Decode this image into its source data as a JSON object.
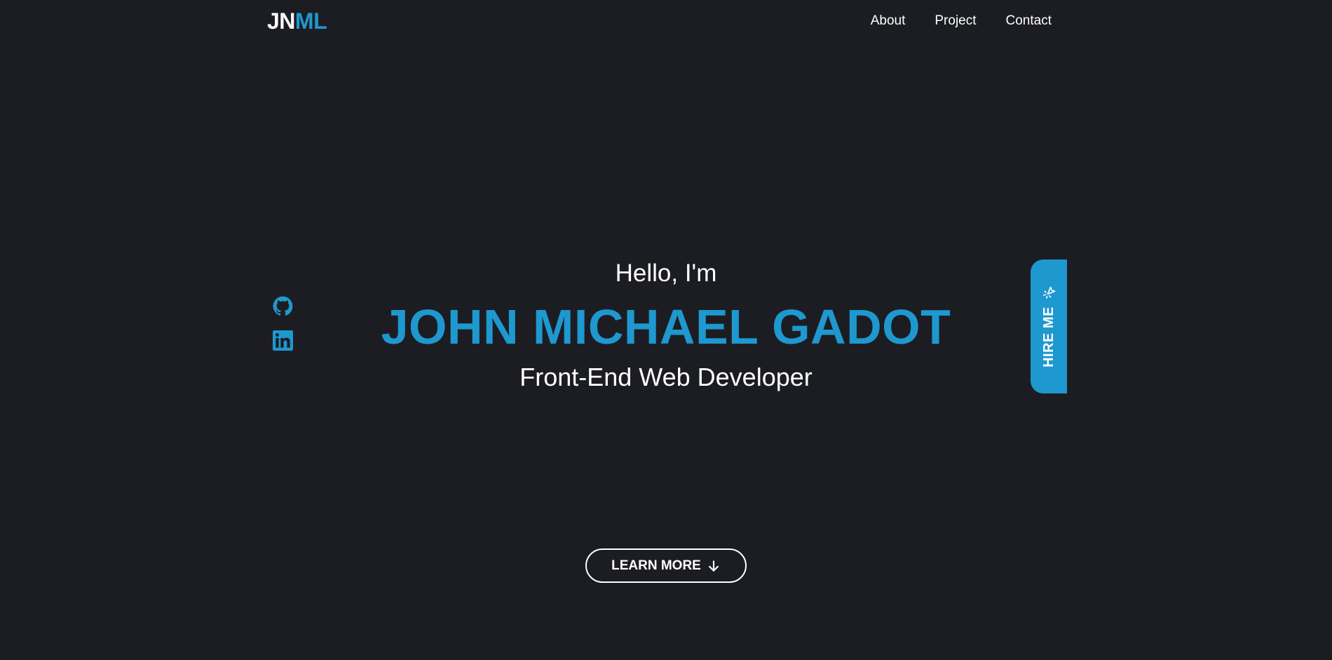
{
  "header": {
    "logo": {
      "part1": "JN",
      "part2": "ML"
    },
    "nav": [
      {
        "label": "About"
      },
      {
        "label": "Project"
      },
      {
        "label": "Contact"
      }
    ]
  },
  "social": [
    {
      "icon": "github-icon"
    },
    {
      "icon": "linkedin-icon"
    }
  ],
  "hero": {
    "greeting": "Hello, I'm",
    "name": "JOHN MICHAEL GADOT",
    "role": "Front-End Web Developer"
  },
  "hire_button": {
    "label": "HIRE ME",
    "icon": "cursor-click-icon"
  },
  "learn_more_button": {
    "label": "LEARN MORE",
    "icon": "arrow-down-icon"
  },
  "colors": {
    "background": "#1c1d22",
    "accent": "#1e98cf",
    "text": "#ffffff"
  }
}
